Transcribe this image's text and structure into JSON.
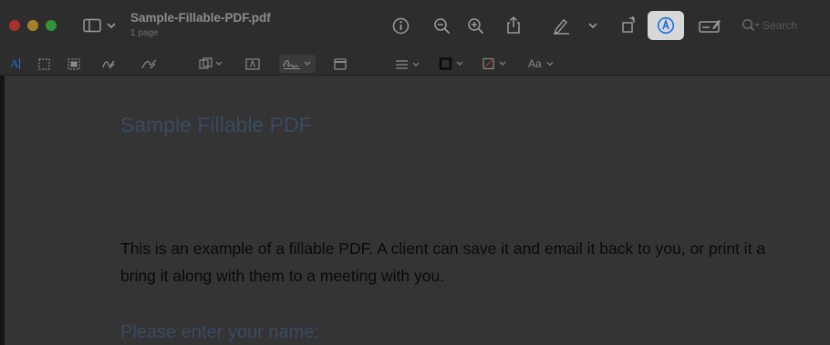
{
  "window": {
    "title": "Sample-Fillable-PDF.pdf",
    "subtitle": "1 page",
    "search_placeholder": "Search"
  },
  "toolbar": {
    "icons": [
      "sidebar-icon",
      "chevron-down-icon",
      "info-icon",
      "zoom-out-icon",
      "zoom-in-icon",
      "share-icon",
      "highlight-pen-icon",
      "chevron-down-icon",
      "rotate-icon",
      "markup-icon",
      "form-filling-icon",
      "search-icon"
    ],
    "active": "markup-icon"
  },
  "markup_toolbar": {
    "text_selection_label": "A",
    "text_style_label": "Aa",
    "tools": [
      "text-selection-tool",
      "rectangular-selection-tool",
      "smart-lasso-tool",
      "sketch-tool",
      "draw-tool",
      "shapes-tool",
      "text-box-tool",
      "sign-tool",
      "note-tool",
      "shape-style-tool",
      "border-color-tool",
      "fill-color-tool",
      "text-style-tool"
    ]
  },
  "document": {
    "heading": "Sample Fillable PDF",
    "body_line1": "This is an example of a fillable PDF. A client can save it and email it back to you, or print it a",
    "body_line2": "bring it along with them to a meeting with you.",
    "field_label": "Please enter your name:"
  },
  "colors": {
    "accent": "#1a6fe0",
    "close": "#a5322c",
    "minimize": "#a7802a",
    "zoom": "#339337",
    "heading": "#3b4a61"
  }
}
